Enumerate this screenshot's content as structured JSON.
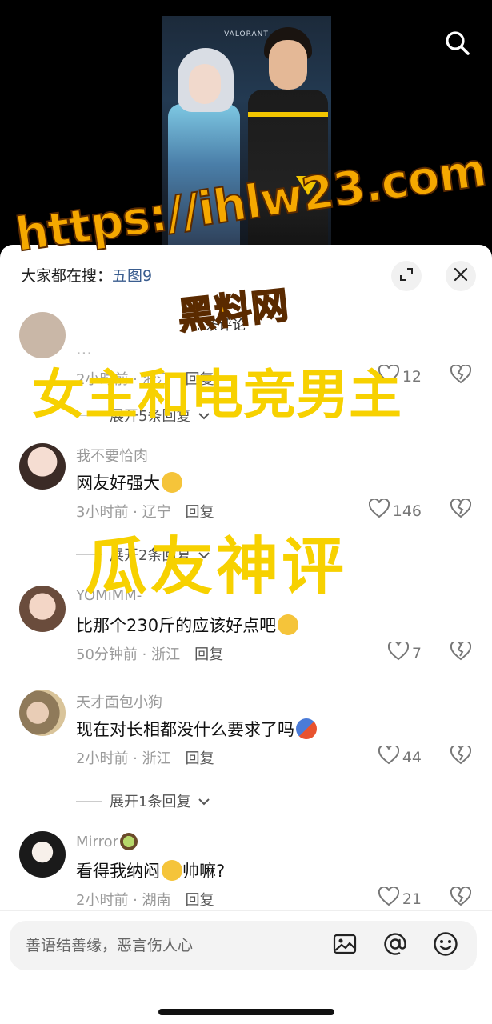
{
  "video": {
    "brand_text": "VALORANT"
  },
  "header": {
    "suggest_prefix": "大家都在搜：",
    "suggest_term": "五图9",
    "comment_count_text": "...条评论"
  },
  "comments": [
    {
      "user": "Y... ...",
      "text": "...",
      "time_loc": "2小时前 · 浙江",
      "reply_label": "回复",
      "likes": "12",
      "expand_label": "展开5条回复"
    },
    {
      "user": "我不要恰肉",
      "text": "网友好强大",
      "time_loc": "3小时前 · 辽宁",
      "reply_label": "回复",
      "likes": "146",
      "expand_label": "展开2条回复"
    },
    {
      "user": "YOMiMM-",
      "text": "比那个230斤的应该好点吧",
      "time_loc": "50分钟前 · 浙江",
      "reply_label": "回复",
      "likes": "7"
    },
    {
      "user": "天才面包小狗",
      "text": "现在对长相都没什么要求了吗",
      "time_loc": "2小时前 · 浙江",
      "reply_label": "回复",
      "likes": "44",
      "expand_label": "展开1条回复"
    },
    {
      "user": "Mirror",
      "text_a": "看得我纳闷",
      "text_b": "帅嘛?",
      "time_loc": "2小时前 · 湖南",
      "reply_label": "回复",
      "likes": "21"
    }
  ],
  "input": {
    "placeholder": "善语结善缘，恶言伤人心"
  },
  "overlay": {
    "url": "https://ihlw23.com",
    "site": "黑料网",
    "title": "女主和电竞男主",
    "subtitle": "瓜友神评"
  },
  "colors": {
    "watermark_orange": "#f5a800",
    "watermark_yellow": "#f7d100",
    "sheet_bg": "#ffffff",
    "input_bg": "#f3f3f3"
  }
}
